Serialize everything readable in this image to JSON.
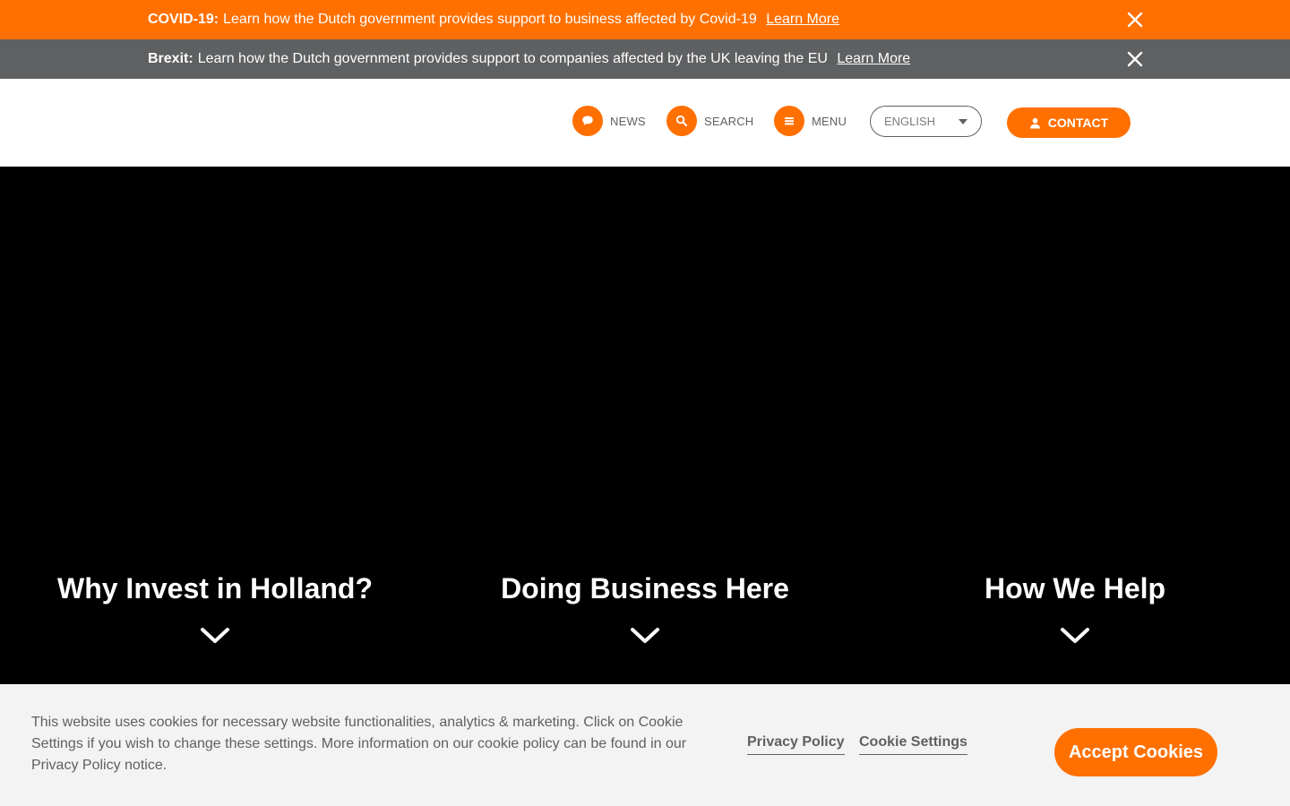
{
  "banners": {
    "covid": {
      "label": "COVID-19:",
      "text": "Learn how the Dutch government provides support to business affected by Covid-19",
      "link": "Learn More"
    },
    "brexit": {
      "label": "Brexit:",
      "text": "Learn how the Dutch government provides support to companies affected by the UK leaving the EU",
      "link": "Learn More"
    }
  },
  "header": {
    "nav": [
      {
        "label": "NEWS",
        "icon": "chat-bubble-icon"
      },
      {
        "label": "SEARCH",
        "icon": "search-icon"
      },
      {
        "label": "MENU",
        "icon": "hamburger-icon"
      }
    ],
    "language": {
      "selected": "ENGLISH"
    },
    "contact": {
      "label": "CONTACT",
      "icon": "user-icon"
    }
  },
  "hero": {
    "sections": [
      {
        "title": "Why Invest in Holland?",
        "icon": "chevron-down-icon"
      },
      {
        "title": "Doing Business Here",
        "icon": "chevron-down-icon"
      },
      {
        "title": "How We Help",
        "icon": "chevron-down-icon"
      }
    ]
  },
  "cookie_banner": {
    "text": "This website uses cookies for necessary website functionalities, analytics & marketing. Click on Cookie Settings if you wish to change these settings. More information on our cookie policy can be found in our Privacy Policy notice.",
    "privacy_link": "Privacy Policy",
    "settings_link": "Cookie Settings",
    "accept": "Accept Cookies"
  },
  "colors": {
    "accent": "#ff7000",
    "gray_bar": "#5e6062",
    "hero_bg": "#000000",
    "cookie_bg": "#f3f3f3"
  }
}
